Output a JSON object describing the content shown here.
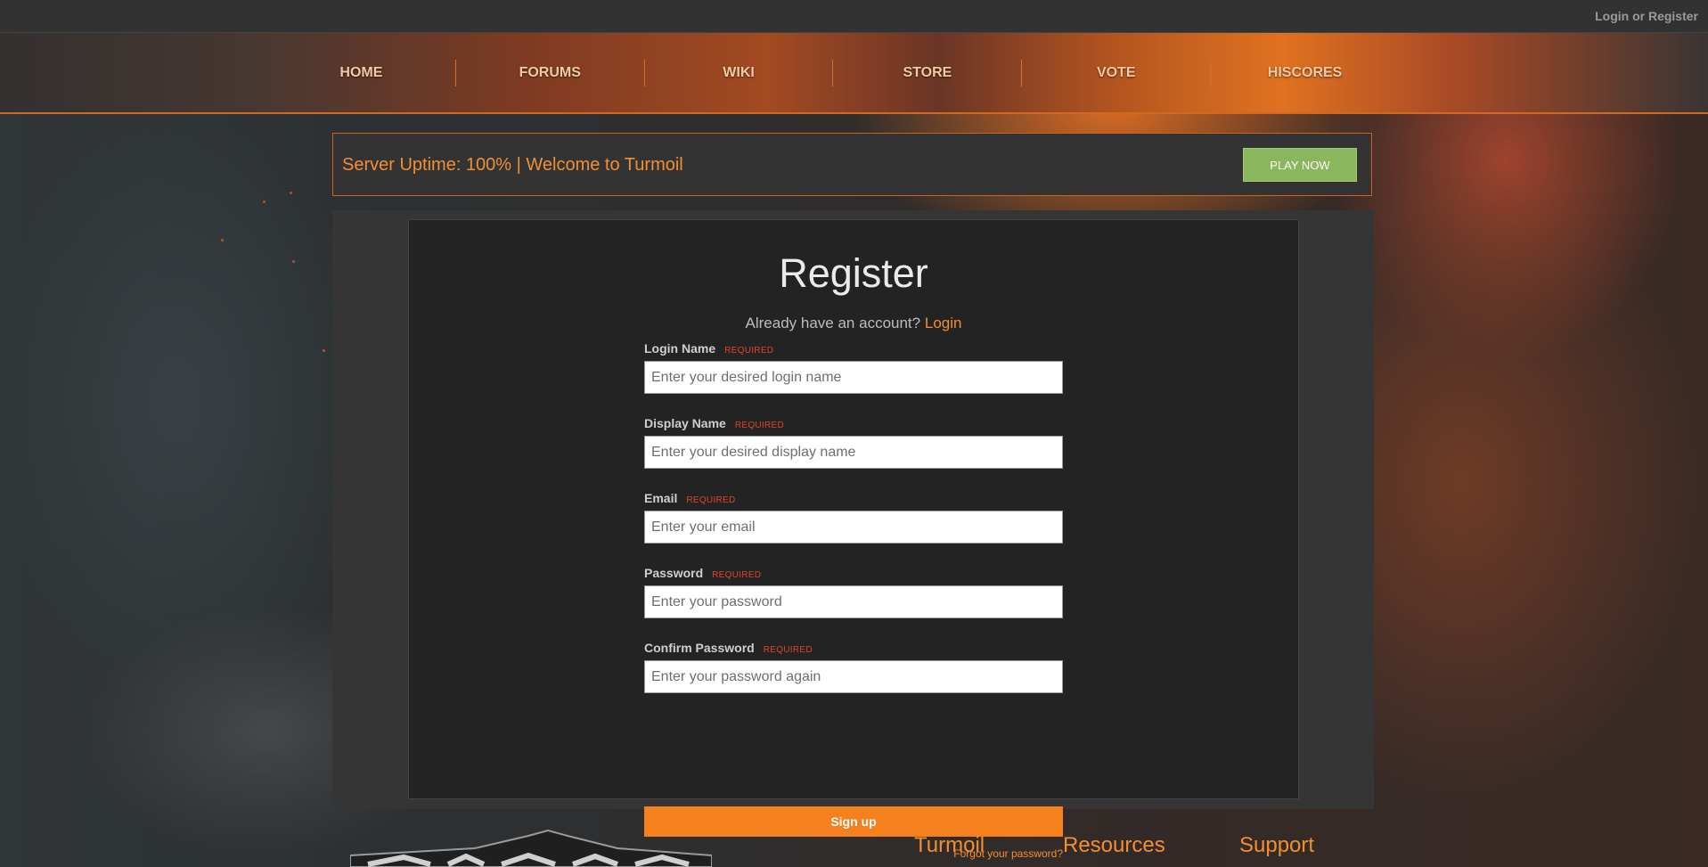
{
  "topbar": {
    "auth_link": "Login or Register"
  },
  "nav": {
    "items": [
      "HOME",
      "FORUMS",
      "WIKI",
      "STORE",
      "VOTE",
      "HISCORES"
    ]
  },
  "announcement": {
    "text": "Server Uptime: 100% | Welcome to Turmoil",
    "play_button": "PLAY NOW"
  },
  "register": {
    "title": "Register",
    "already_text": "Already have an account?",
    "login_link": "Login",
    "required_tag": "REQUIRED",
    "fields": [
      {
        "label": "Login Name",
        "placeholder": "Enter your desired login name"
      },
      {
        "label": "Display Name",
        "placeholder": "Enter your desired display name"
      },
      {
        "label": "Email",
        "placeholder": "Enter your email"
      },
      {
        "label": "Password",
        "placeholder": "Enter your password"
      },
      {
        "label": "Confirm Password",
        "placeholder": "Enter your password again"
      }
    ],
    "submit": "Sign up",
    "forgot": "Forgot your password?"
  },
  "footer": {
    "columns": [
      "Turmoil",
      "Resources",
      "Support"
    ]
  },
  "colors": {
    "accent": "#f28f33",
    "signup": "#f5801e",
    "play": "#8ab65e",
    "required": "#e0442a"
  }
}
